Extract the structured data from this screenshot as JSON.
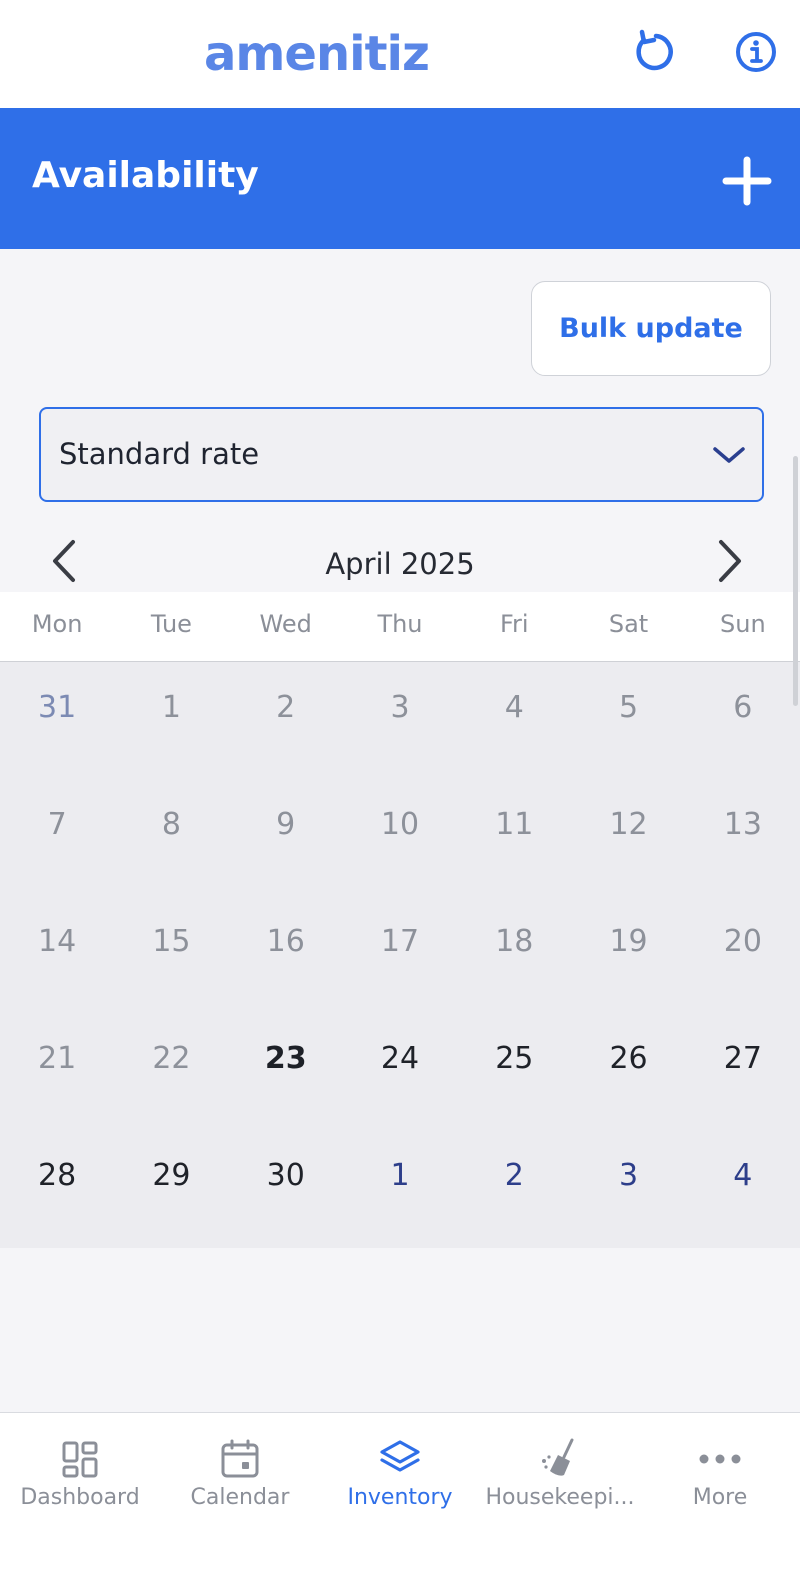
{
  "header": {
    "logo": "amenitiz",
    "refresh_icon": "refresh-icon",
    "info_icon": "info-icon"
  },
  "titlebar": {
    "title": "Availability",
    "add_icon": "plus-icon"
  },
  "toolbar": {
    "bulk_update_label": "Bulk update"
  },
  "rate_select": {
    "value": "Standard rate"
  },
  "calendar": {
    "month_label": "April 2025",
    "weekdays": [
      "Mon",
      "Tue",
      "Wed",
      "Thu",
      "Fri",
      "Sat",
      "Sun"
    ],
    "weeks": [
      [
        "31",
        "1",
        "2",
        "3",
        "4",
        "5",
        "6"
      ],
      [
        "7",
        "8",
        "9",
        "10",
        "11",
        "12",
        "13"
      ],
      [
        "14",
        "15",
        "16",
        "17",
        "18",
        "19",
        "20"
      ],
      [
        "21",
        "22",
        "23",
        "24",
        "25",
        "26",
        "27"
      ],
      [
        "28",
        "29",
        "30",
        "1",
        "2",
        "3",
        "4"
      ]
    ]
  },
  "bottom_nav": {
    "items": [
      {
        "label": "Dashboard",
        "icon": "dashboard-icon"
      },
      {
        "label": "Calendar",
        "icon": "calendar-icon"
      },
      {
        "label": "Inventory",
        "icon": "layers-icon"
      },
      {
        "label": "Housekeepi...",
        "icon": "broom-icon"
      },
      {
        "label": "More",
        "icon": "more-icon"
      }
    ],
    "active": "Inventory"
  },
  "colors": {
    "primary": "#2f6fe8",
    "logo": "#5a86e6",
    "muted_text": "#8b8f98"
  }
}
